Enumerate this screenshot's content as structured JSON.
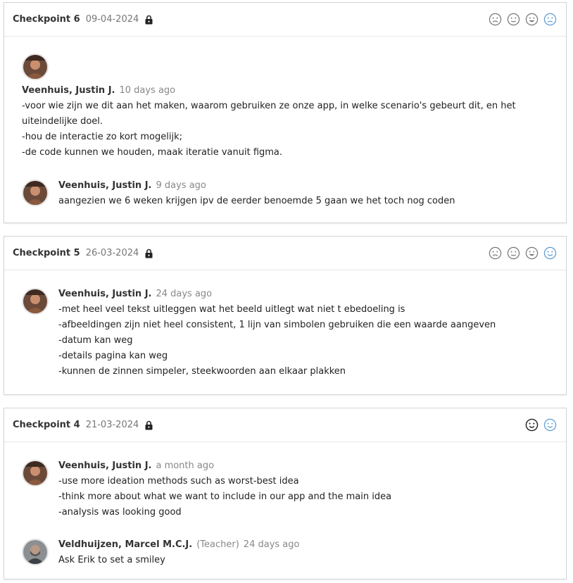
{
  "checkpoints": [
    {
      "title": "Checkpoint 6",
      "date": "09-04-2024",
      "comments": [
        {
          "author": "Veenhuis, Justin J.",
          "ago": "10 days ago",
          "lines": [
            "-voor wie zijn we dit aan het maken, waarom gebruiken ze onze app, in welke scenario's gebeurt dit, en het uiteindelijke doel.",
            "-hou de interactie zo kort mogelijk;",
            "-de code kunnen we houden, maak iteratie vanuit figma."
          ]
        },
        {
          "author": "Veenhuis, Justin J.",
          "ago": "9 days ago",
          "lines": [
            "aangezien we 6 weken krijgen ipv de eerder benoemde 5 gaan we het toch nog coden"
          ]
        }
      ]
    },
    {
      "title": "Checkpoint 5",
      "date": "26-03-2024",
      "comments": [
        {
          "author": "Veenhuis, Justin J.",
          "ago": "24 days ago",
          "lines": [
            "-met heel veel tekst uitleggen wat het beeld uitlegt wat niet t ebedoeling is",
            "-afbeeldingen zijn niet heel consistent, 1 lijn van simbolen gebruiken die een waarde aangeven",
            "-datum kan weg",
            "-details pagina kan weg",
            "-kunnen de zinnen simpeler, steekwoorden aan elkaar plakken"
          ]
        }
      ]
    },
    {
      "title": "Checkpoint 4",
      "date": "21-03-2024",
      "comments": [
        {
          "author": "Veenhuis, Justin J.",
          "ago": "a month ago",
          "lines": [
            "-use more ideation methods such as worst-best idea",
            "-think more about what we want to include in our app and the main idea",
            "-analysis was looking good"
          ]
        },
        {
          "author": "Veldhuijzen, Marcel M.C.J.",
          "role": "(Teacher)",
          "ago": "24 days ago",
          "lines": [
            "Ask Erik to set a smiley"
          ]
        }
      ]
    }
  ],
  "colors": {
    "smiley_outline": "#777777",
    "smiley_selected": "#5b9bd5",
    "smiley_dark": "#222222"
  },
  "icons": [
    "lock-icon",
    "sad-smiley-icon",
    "neutral-smiley-icon",
    "happy-smiley-icon",
    "worried-smiley-icon",
    "avatar"
  ]
}
